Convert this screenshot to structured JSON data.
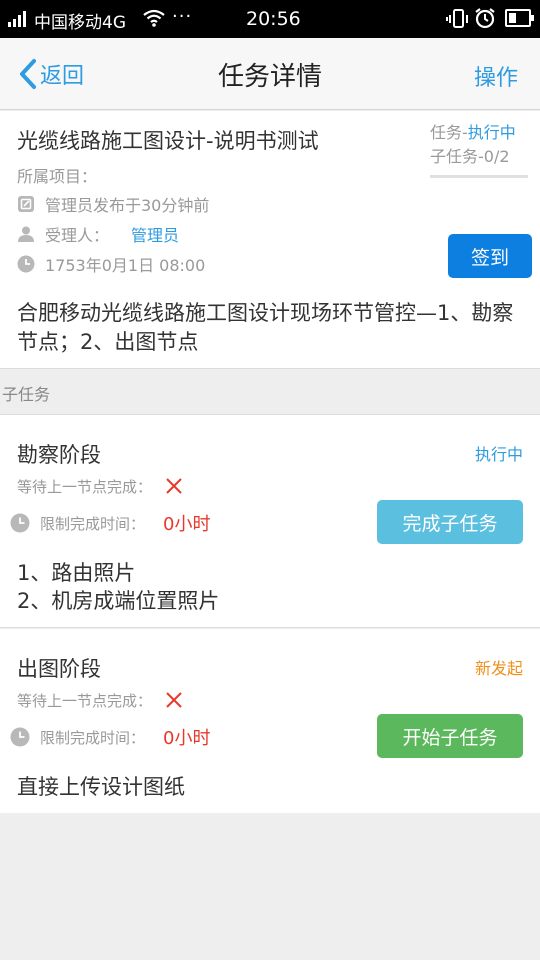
{
  "status_bar": {
    "carrier": "中国移动4G",
    "dots": "···",
    "time": "20:56",
    "icons": [
      "signal-icon",
      "wifi-icon",
      "vibrate-icon",
      "alarm-icon",
      "battery-icon"
    ]
  },
  "nav": {
    "back_label": "返回",
    "title": "任务详情",
    "action_label": "操作"
  },
  "task": {
    "name": "光缆线路施工图设计-说明书测试",
    "project_label": "所属项目：",
    "publish_text": "管理员发布于30分钟前",
    "assignee_label": "受理人：",
    "assignee_name": "管理员",
    "date": "1753年0月1日 08:00",
    "status_prefix": "任务-",
    "status_value": "执行中",
    "subtask_count": "子任务-0/2",
    "signin_label": "签到",
    "description": "合肥移动光缆线路施工图设计现场环节管控—1、勘察节点；2、出图节点"
  },
  "section": {
    "subtasks_header": "子任务"
  },
  "subtasks": [
    {
      "title": "勘察阶段",
      "status": "执行中",
      "status_color": "#2f9be0",
      "wait_label": "等待上一节点完成：",
      "limit_label": "限制完成时间：",
      "limit_value": "0小时",
      "button_label": "完成子任务",
      "note_lines": [
        "1、路由照片",
        "2、机房成端位置照片"
      ]
    },
    {
      "title": "出图阶段",
      "status": "新发起",
      "status_color": "#f0901c",
      "wait_label": "等待上一节点完成：",
      "limit_label": "限制完成时间：",
      "limit_value": "0小时",
      "button_label": "开始子任务",
      "note_lines": [
        "直接上传设计图纸"
      ]
    }
  ],
  "colors": {
    "accent": "#2f9be0",
    "primary_button": "#0d7fe0",
    "complete_button": "#5bbfe0",
    "start_button": "#5cb85c",
    "danger": "#e8382b"
  }
}
